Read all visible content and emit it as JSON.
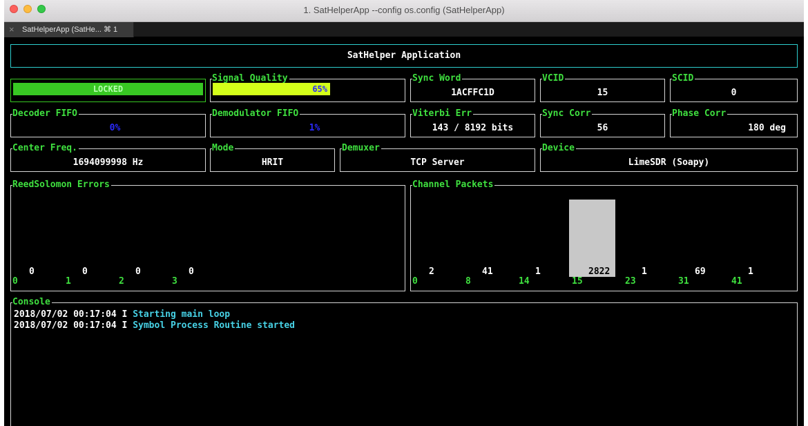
{
  "window": {
    "title": "1. SatHelperApp --config os.config (SatHelperApp)"
  },
  "tab": {
    "label": "SatHelperApp (SatHe... ⌘ 1"
  },
  "colors": {
    "locked": "#38c823",
    "signal": "#d4ff1a",
    "label": "#3fe03f",
    "console_msg": "#47d2e6",
    "fifo": "#2a2aff"
  },
  "header": {
    "title": "SatHelper Application"
  },
  "status": {
    "locked_label": "LOCKED",
    "locked_fraction": 1.0
  },
  "signal_quality": {
    "label": "Signal Quality",
    "text": "65%",
    "fraction": 0.65
  },
  "sync_word": {
    "label": "Sync Word",
    "value": "1ACFFC1D"
  },
  "vcid": {
    "label": "VCID",
    "value": "15"
  },
  "scid": {
    "label": "SCID",
    "value": "0"
  },
  "decoder_fifo": {
    "label": "Decoder FIFO",
    "value": "0%"
  },
  "demod_fifo": {
    "label": "Demodulator FIFO",
    "value": "1%"
  },
  "viterbi": {
    "label": "Viterbi Err",
    "value": "143 / 8192 bits"
  },
  "sync_corr": {
    "label": "Sync Corr",
    "value": "56"
  },
  "phase_corr": {
    "label": "Phase Corr",
    "value": "180 deg"
  },
  "center_freq": {
    "label": "Center Freq.",
    "value": "1694099998 Hz"
  },
  "mode": {
    "label": "Mode",
    "value": "HRIT"
  },
  "demuxer": {
    "label": "Demuxer",
    "value": "TCP Server"
  },
  "device": {
    "label": "Device",
    "value": "LimeSDR (Soapy)"
  },
  "rs_errors": {
    "label": "ReedSolomon Errors",
    "categories": [
      "0",
      "1",
      "2",
      "3"
    ],
    "values": [
      "0",
      "0",
      "0",
      "0"
    ]
  },
  "channel_packets": {
    "label": "Channel Packets",
    "categories": [
      "0",
      "8",
      "14",
      "15",
      "23",
      "31",
      "41"
    ],
    "values": [
      "2",
      "41",
      "1",
      "2822",
      "1",
      "69",
      "1"
    ]
  },
  "console": {
    "label": "Console",
    "lines": [
      {
        "ts": "2018/07/02 00:17:04",
        "level": "I",
        "msg": "Starting main loop"
      },
      {
        "ts": "2018/07/02 00:17:04",
        "level": "I",
        "msg": "Symbol Process Routine started"
      }
    ]
  }
}
